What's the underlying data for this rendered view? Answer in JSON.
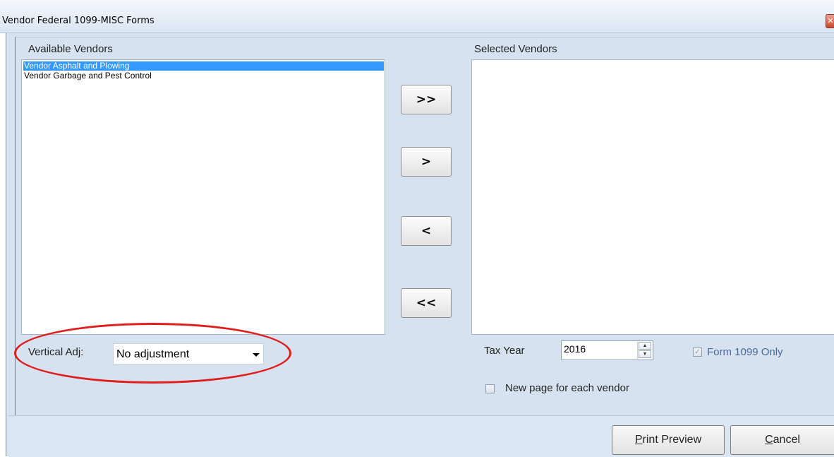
{
  "window": {
    "title": "Vendor Federal 1099-MISC Forms",
    "close_glyph": "✕"
  },
  "available": {
    "label": "Available Vendors",
    "items": [
      {
        "label": "Vendor Asphalt and Plowing",
        "selected": true
      },
      {
        "label": "Vendor Garbage and Pest Control",
        "selected": false
      }
    ]
  },
  "selected": {
    "label": "Selected Vendors",
    "items": []
  },
  "move_buttons": {
    "add_all": ">>",
    "add": ">",
    "remove": "<",
    "remove_all": "<<"
  },
  "vertical_adj": {
    "label": "Vertical Adj:",
    "value": "No adjustment"
  },
  "tax_year": {
    "label": "Tax Year",
    "value": "2016",
    "up_glyph": "▲",
    "down_glyph": "▼"
  },
  "form_1099_only": {
    "label": "Form 1099 Only",
    "checked": true,
    "enabled": false,
    "check_glyph": "✓"
  },
  "new_page": {
    "label": "New page for each vendor",
    "checked": false
  },
  "buttons": {
    "print_preview_mnemonic": "P",
    "print_preview_rest": "rint Preview",
    "cancel_mnemonic": "C",
    "cancel_rest": "ancel"
  },
  "colors": {
    "selection": "#3399ff",
    "highlight_ellipse": "#e01e1e",
    "disabled_text": "#4a6a96"
  }
}
